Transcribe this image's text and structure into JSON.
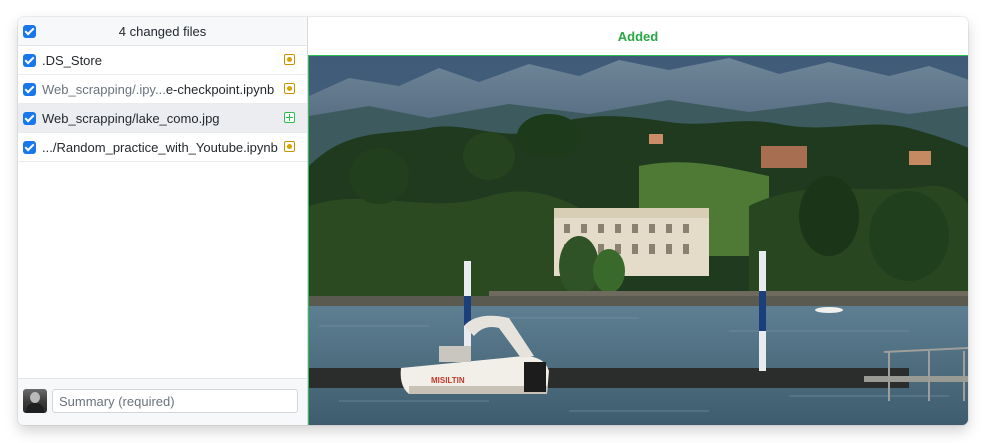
{
  "header": {
    "title": "4 changed files"
  },
  "files": [
    {
      "prefix": ".DS_Store",
      "suffix": "",
      "status": "modified"
    },
    {
      "prefix": "Web_scrapping/.ipy...",
      "suffix": "e-checkpoint.ipynb",
      "status": "modified"
    },
    {
      "prefix": "Web_scrapping/lake_como.jpg",
      "suffix": "",
      "status": "added"
    },
    {
      "prefix": ".../Random_practice_with_Youtube.ipynb",
      "suffix": "",
      "status": "modified"
    }
  ],
  "commit": {
    "summary_placeholder": "Summary (required)"
  },
  "diff": {
    "label": "Added",
    "image_name": "lake_como.jpg"
  },
  "colors": {
    "accent": "#1877ea",
    "added": "#28a745",
    "modified": "#d9a300",
    "selected_row": "#ebedf0"
  },
  "icons": {
    "select_all": "checkbox-checked-icon",
    "modified": "file-modified-icon",
    "added": "file-added-icon"
  }
}
